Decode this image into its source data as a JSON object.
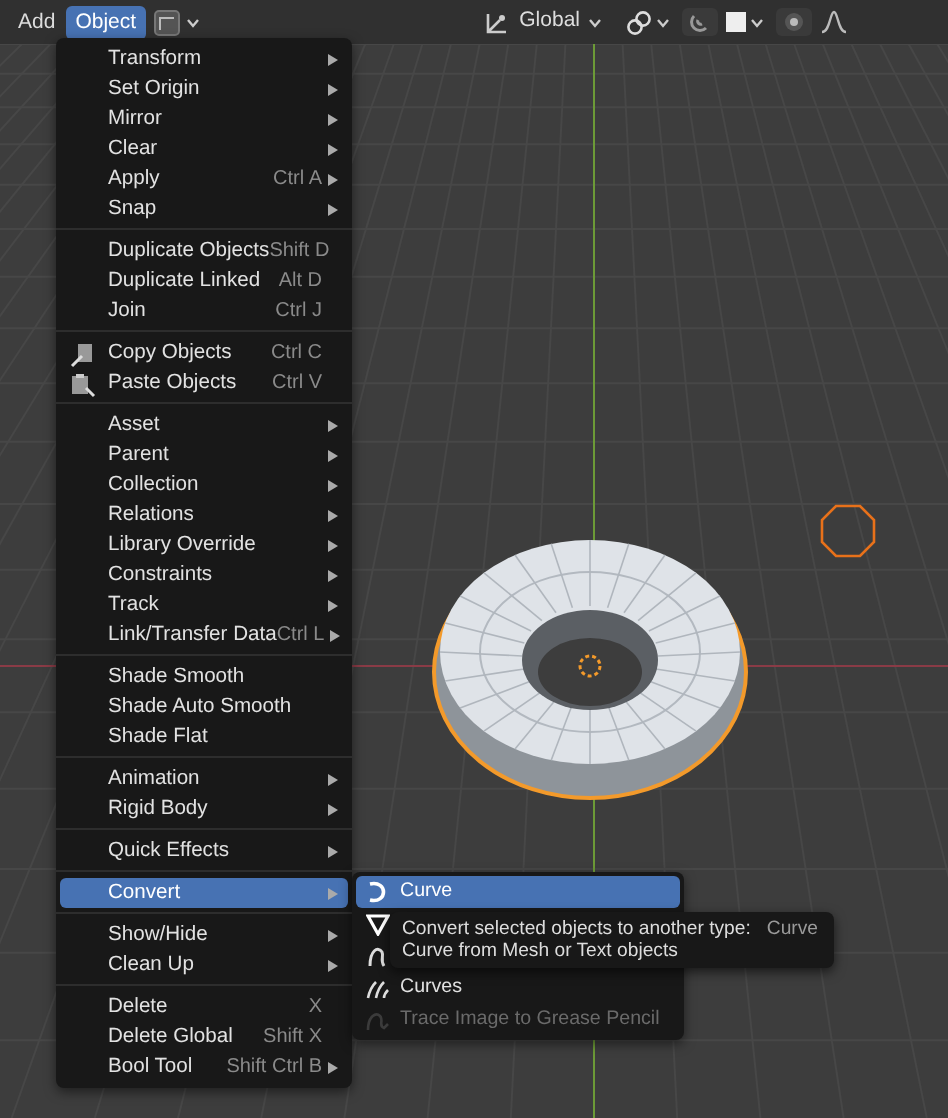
{
  "header": {
    "menus": [
      {
        "label": "Add",
        "selected": false
      },
      {
        "label": "Object",
        "selected": true
      }
    ],
    "orientation": "Global"
  },
  "object_menu": {
    "sections": [
      [
        {
          "label": "Transform",
          "submenu": true
        },
        {
          "label": "Set Origin",
          "submenu": true
        },
        {
          "label": "Mirror",
          "submenu": true
        },
        {
          "label": "Clear",
          "submenu": true
        },
        {
          "label": "Apply",
          "shortcut": "Ctrl A",
          "submenu": true
        },
        {
          "label": "Snap",
          "submenu": true
        }
      ],
      [
        {
          "label": "Duplicate Objects",
          "shortcut": "Shift D"
        },
        {
          "label": "Duplicate Linked",
          "shortcut": "Alt D"
        },
        {
          "label": "Join",
          "shortcut": "Ctrl J"
        }
      ],
      [
        {
          "label": "Copy Objects",
          "shortcut": "Ctrl C",
          "kind": "copy"
        },
        {
          "label": "Paste Objects",
          "shortcut": "Ctrl V",
          "kind": "paste"
        }
      ],
      [
        {
          "label": "Asset",
          "submenu": true
        },
        {
          "label": "Parent",
          "submenu": true
        },
        {
          "label": "Collection",
          "submenu": true
        },
        {
          "label": "Relations",
          "submenu": true
        },
        {
          "label": "Library Override",
          "submenu": true
        },
        {
          "label": "Constraints",
          "submenu": true
        },
        {
          "label": "Track",
          "submenu": true
        },
        {
          "label": "Link/Transfer Data",
          "shortcut": "Ctrl L",
          "submenu": true
        }
      ],
      [
        {
          "label": "Shade Smooth"
        },
        {
          "label": "Shade Auto Smooth"
        },
        {
          "label": "Shade Flat"
        }
      ],
      [
        {
          "label": "Animation",
          "submenu": true
        },
        {
          "label": "Rigid Body",
          "submenu": true
        }
      ],
      [
        {
          "label": "Quick Effects",
          "submenu": true
        }
      ],
      [
        {
          "label": "Convert",
          "submenu": true,
          "selected": true
        }
      ],
      [
        {
          "label": "Show/Hide",
          "submenu": true
        },
        {
          "label": "Clean Up",
          "submenu": true
        }
      ],
      [
        {
          "label": "Delete",
          "shortcut": "X"
        },
        {
          "label": "Delete Global",
          "shortcut": "Shift X"
        },
        {
          "label": "Bool Tool",
          "shortcut": "Shift Ctrl B",
          "submenu": true
        }
      ]
    ]
  },
  "convert_menu": {
    "items": [
      {
        "kind": "curve",
        "label": "Curve",
        "selected": true,
        "disabled": false
      },
      {
        "kind": "mesh",
        "selected": false,
        "disabled": false
      },
      {
        "kind": "curve-from-mesh",
        "selected": false,
        "disabled": false
      },
      {
        "kind": "curves",
        "label": "Curves",
        "selected": false,
        "disabled": false
      },
      {
        "kind": "grease-pencil",
        "label": "Trace Image to Grease Pencil",
        "selected": false,
        "disabled": true
      }
    ]
  },
  "tooltip": {
    "title": "Convert selected objects to another type:",
    "value": "Curve",
    "description": "Curve from Mesh or Text objects"
  }
}
